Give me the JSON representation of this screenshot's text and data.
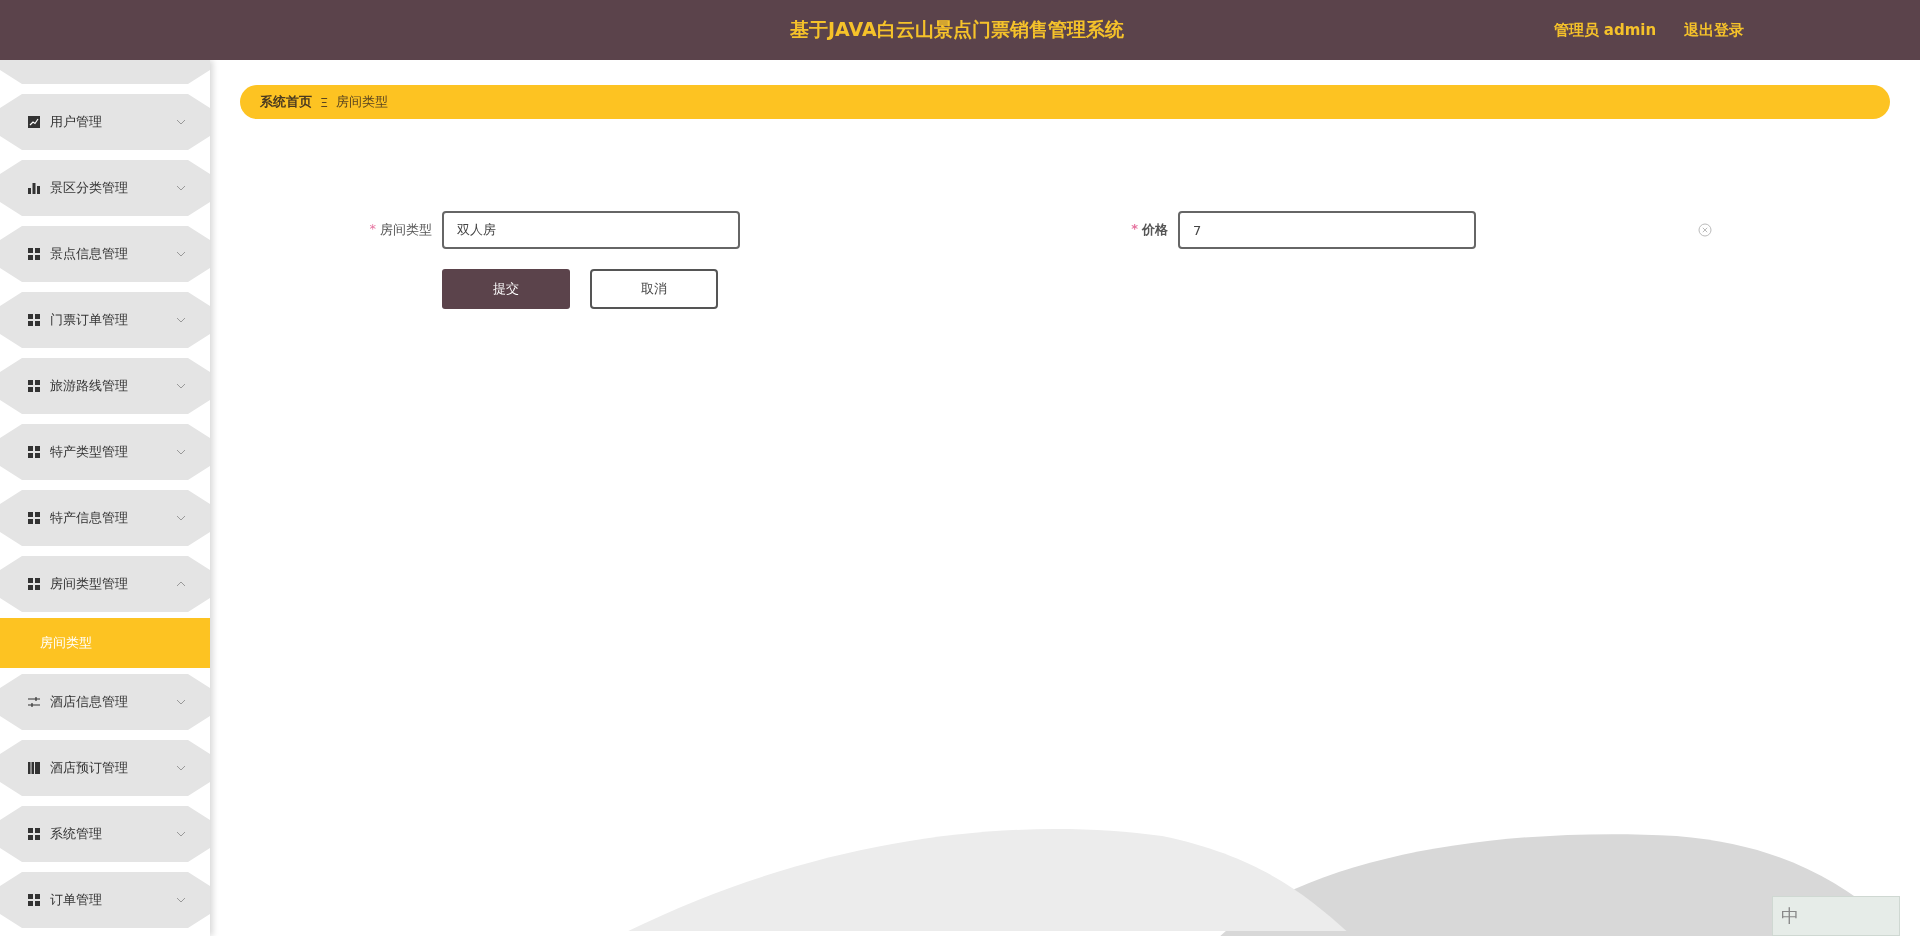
{
  "header": {
    "title": "基于JAVA白云山景点门票销售管理系统",
    "user": "管理员 admin",
    "logout": "退出登录"
  },
  "sidebar": {
    "items": [
      {
        "label": "用户管理",
        "kind": "line-chart",
        "expanded": false
      },
      {
        "label": "景区分类管理",
        "kind": "bar-chart",
        "expanded": false
      },
      {
        "label": "景点信息管理",
        "kind": "grid",
        "expanded": false
      },
      {
        "label": "门票订单管理",
        "kind": "grid",
        "expanded": false
      },
      {
        "label": "旅游路线管理",
        "kind": "grid",
        "expanded": false
      },
      {
        "label": "特产类型管理",
        "kind": "grid",
        "expanded": false
      },
      {
        "label": "特产信息管理",
        "kind": "grid",
        "expanded": false
      },
      {
        "label": "房间类型管理",
        "kind": "grid",
        "expanded": true,
        "children": [
          {
            "label": "房间类型",
            "selected": true
          }
        ]
      },
      {
        "label": "酒店信息管理",
        "kind": "sliders",
        "expanded": false
      },
      {
        "label": "酒店预订管理",
        "kind": "book",
        "expanded": false
      },
      {
        "label": "系统管理",
        "kind": "grid",
        "expanded": false
      },
      {
        "label": "订单管理",
        "kind": "grid",
        "expanded": false
      }
    ]
  },
  "breadcrumb": {
    "home": "系统首页",
    "separator": "Ξ",
    "current": "房间类型"
  },
  "form": {
    "fields": [
      {
        "label": "房间类型",
        "required_mark": "*",
        "value": "双人房"
      },
      {
        "label": "价格",
        "required_mark": "*",
        "value": "7"
      }
    ],
    "submit": "提交",
    "cancel": "取消"
  },
  "ime": {
    "label": "中"
  }
}
